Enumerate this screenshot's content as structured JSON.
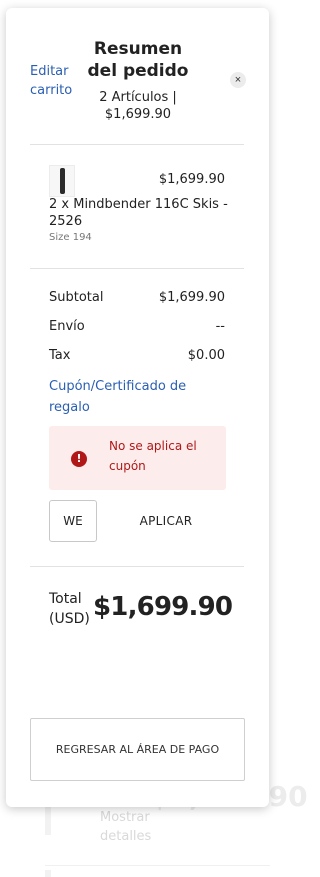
{
  "background": {
    "total_amount": "$1,699.90",
    "details_link": "Mostrar detalles"
  },
  "header": {
    "edit_cart_link": "Editar carrito",
    "title": "Resumen del pedido",
    "subtitle": "2 Artículos | $1,699.90",
    "close_label": "×"
  },
  "item": {
    "image_icon": "ski-thumbnail",
    "price": "$1,699.90",
    "name": "2 x Mindbender 116C Skis - 2526",
    "size": "Size 194"
  },
  "summary": {
    "rows": [
      {
        "label": "Subtotal",
        "value": "$1,699.90"
      },
      {
        "label": "Envío",
        "value": "--"
      },
      {
        "label": "Tax",
        "value": "$0.00"
      }
    ]
  },
  "coupon": {
    "link": "Cupón/Certificado de regalo",
    "alert_icon": "error-icon",
    "alert_icon_glyph": "!",
    "alert_text": "No se aplica el cupón",
    "input_value": "WE",
    "apply_label": "APLICAR"
  },
  "total": {
    "label": "Total (USD)",
    "amount": "$1,699.90"
  },
  "footer": {
    "back_button": "REGRESAR AL ÁREA DE PAGO"
  },
  "colors": {
    "link": "#2b5fb3",
    "error": "#b01818",
    "error_bg": "#fdecec"
  }
}
